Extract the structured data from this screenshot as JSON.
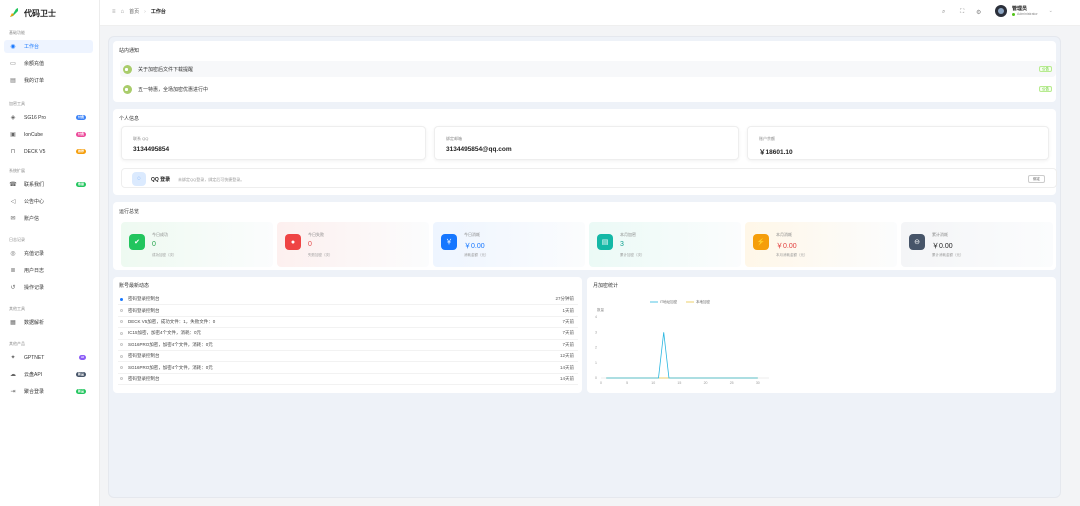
{
  "brand": {
    "title": "代码卫士",
    "accent": "#1677ff"
  },
  "sidebar": {
    "sections": [
      {
        "title": "基础功能"
      },
      {
        "title": "加密工具"
      },
      {
        "title": "系统扩展"
      },
      {
        "title": "日志记录"
      },
      {
        "title": "其他工具"
      },
      {
        "title": "其他产品"
      }
    ],
    "items": [
      {
        "label": "工作台",
        "icon": "dashboard-icon",
        "active": true
      },
      {
        "label": "余额充值",
        "icon": "wallet-icon"
      },
      {
        "label": "我的订单",
        "icon": "orders-icon"
      },
      {
        "label": "SG16 Pro",
        "icon": "shield-icon",
        "badge": "付费",
        "badge_color": "#3b82f6"
      },
      {
        "label": "IonCube",
        "icon": "cube-icon",
        "badge": "付费",
        "badge_color": "#ec4899"
      },
      {
        "label": "DECK V5",
        "icon": "lock-icon",
        "badge": "推荐",
        "badge_color": "#f59e0b"
      },
      {
        "label": "联系我们",
        "icon": "contact-icon",
        "badge": "客服",
        "badge_color": "#22c55e"
      },
      {
        "label": "公告中心",
        "icon": "megaphone-icon"
      },
      {
        "label": "账户信",
        "icon": "mail-icon"
      },
      {
        "label": "充值记录",
        "icon": "record-icon"
      },
      {
        "label": "用户日志",
        "icon": "log-icon"
      },
      {
        "label": "操作记录",
        "icon": "history-icon"
      },
      {
        "label": "数据解析",
        "icon": "parse-icon"
      },
      {
        "label": "GPTNET",
        "icon": "chat-icon",
        "badge": "AI",
        "badge_color": "#8b5cf6"
      },
      {
        "label": "云盘API",
        "icon": "cloud-icon",
        "badge": "新品",
        "badge_color": "#475569"
      },
      {
        "label": "聚合登录",
        "icon": "login-icon",
        "badge": "新品",
        "badge_color": "#22c55e"
      }
    ]
  },
  "header": {
    "breadcrumbs": [
      "首页",
      "工作台"
    ],
    "user": {
      "name": "管理员",
      "role": "Administrator"
    }
  },
  "notices": {
    "title": "站内通知",
    "items": [
      {
        "text": "关于加密后文件下载提醒",
        "tag": "公告"
      },
      {
        "text": "五一特惠，全场加密优惠进行中",
        "tag": "公告"
      }
    ]
  },
  "profile": {
    "title": "个人信息",
    "cards": [
      {
        "label": "联系 QQ",
        "value": "3134495854"
      },
      {
        "label": "绑定邮箱",
        "value": "3134495854@qq.com"
      },
      {
        "label": "账户余额",
        "value": "￥18601.10"
      }
    ],
    "qq": {
      "title": "QQ 登录",
      "desc": "未绑定QQ登录，绑定后可快捷登录。",
      "button": "绑定"
    }
  },
  "overview": {
    "title": "运行总览",
    "stats": [
      {
        "label": "今日成功",
        "value": "0",
        "sub": "成功加密（次）",
        "color": "#22c55e",
        "value_color": "#22a34a",
        "bg": "#eefaf1",
        "icon": "success-icon",
        "glyph": "✔"
      },
      {
        "label": "今日失败",
        "value": "0",
        "sub": "失败加密（次）",
        "color": "#ef4444",
        "value_color": "#e34b4b",
        "bg": "#fdf0ef",
        "icon": "fail-icon",
        "glyph": "●"
      },
      {
        "label": "今日消耗",
        "value": "￥0.00",
        "sub": "消耗金额（元）",
        "color": "#1677ff",
        "value_color": "#1677ff",
        "bg": "#eef5ff",
        "icon": "coin-icon",
        "glyph": "￥"
      },
      {
        "label": "本月加密",
        "value": "3",
        "sub": "累计加密（次）",
        "color": "#14b8a6",
        "value_color": "#0f9f8f",
        "bg": "#ebfaf6",
        "icon": "calendar-icon",
        "glyph": "▤"
      },
      {
        "label": "本月消耗",
        "value": "￥0.00",
        "sub": "本月消耗金额（元）",
        "color": "#f59e0b",
        "value_color": "#e23d3d",
        "bg": "#fff7e8",
        "icon": "pulse-icon",
        "glyph": "⚡"
      },
      {
        "label": "累计消耗",
        "value": "￥0.00",
        "sub": "累计消耗金额（元）",
        "color": "#475569",
        "value_color": "#222222",
        "bg": "#f4f5f7",
        "icon": "minus-circle-icon",
        "glyph": "⊖"
      }
    ]
  },
  "activity": {
    "title": "账号最新动态",
    "items": [
      {
        "text": "密码登录控制台",
        "time": "27分钟前"
      },
      {
        "text": "密码登录控制台",
        "time": "1天前"
      },
      {
        "text": "DECK V5加密，成功文件：1，失败文件：0",
        "time": "7天前"
      },
      {
        "text": "IC15加密，加密4个文件，消耗：0元",
        "time": "7天前"
      },
      {
        "text": "SG16PRO加密，加密4个文件，消耗：0元",
        "time": "7天前"
      },
      {
        "text": "密码登录控制台",
        "time": "12天前"
      },
      {
        "text": "SG16PRO加密，加密4个文件，消耗：0元",
        "time": "14天前"
      },
      {
        "text": "密码登录控制台",
        "time": "14天前"
      }
    ]
  },
  "chart_panel": {
    "title": "月加密统计"
  },
  "chart_data": {
    "type": "line",
    "title": "",
    "ylabel": "数量",
    "x": [
      1,
      2,
      3,
      4,
      5,
      6,
      7,
      8,
      9,
      10,
      11,
      12,
      13,
      14,
      15,
      16,
      17,
      18,
      19,
      20,
      21,
      22,
      23,
      24,
      25,
      26,
      27,
      28,
      29,
      30
    ],
    "x_ticks": [
      0,
      5,
      10,
      15,
      20,
      25,
      30
    ],
    "xlim": [
      0,
      31
    ],
    "ylim": [
      0,
      4
    ],
    "y_ticks": [
      0,
      1,
      2,
      3,
      4
    ],
    "series": [
      {
        "name": "IT地址加密",
        "color": "#29b6e0",
        "values": [
          0,
          0,
          0,
          0,
          0,
          0,
          0,
          0,
          0,
          0,
          0,
          3,
          0,
          0,
          0,
          0,
          0,
          0,
          0,
          0,
          0,
          0,
          0,
          0,
          0,
          0,
          0,
          0,
          0,
          0
        ]
      },
      {
        "name": "本地加密",
        "color": "#e8c64a",
        "values": [
          0,
          0,
          0,
          0,
          0,
          0,
          0,
          0,
          0,
          0,
          0,
          0,
          0,
          0,
          0,
          0,
          0,
          0,
          0,
          0,
          0,
          0,
          0,
          0,
          0,
          0,
          0,
          0,
          0,
          0
        ]
      }
    ],
    "legend": "top-center",
    "grid": false
  }
}
